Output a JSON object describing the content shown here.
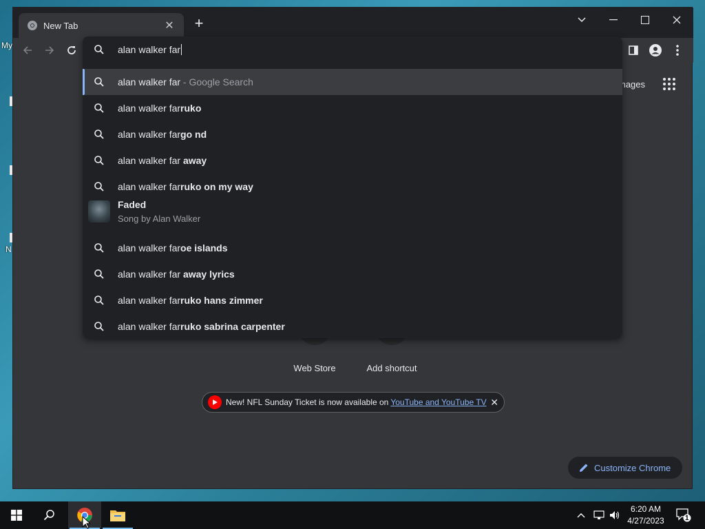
{
  "desktop": {
    "label_top": "My",
    "label_bottom": "N"
  },
  "tab": {
    "title": "New Tab"
  },
  "omnibox": {
    "query": "alan walker far",
    "suggestions": [
      {
        "typed": "alan walker far",
        "rest": "",
        "suffix": " - Google Search"
      },
      {
        "typed": "alan walker far",
        "rest": "ruko"
      },
      {
        "typed": "alan walker far",
        "rest": "go nd"
      },
      {
        "typed": "alan walker far ",
        "rest": "away"
      },
      {
        "typed": "alan walker far",
        "rest": "ruko on my way"
      },
      {
        "typed": "alan walker far",
        "rest": "oe islands"
      },
      {
        "typed": "alan walker far ",
        "rest": "away lyrics"
      },
      {
        "typed": "alan walker far",
        "rest": "ruko hans zimmer"
      },
      {
        "typed": "alan walker far",
        "rest": "ruko sabrina carpenter"
      }
    ],
    "entity": {
      "title": "Faded",
      "subtitle": "Song by Alan Walker"
    }
  },
  "ntp": {
    "images_link": "mages",
    "shortcuts": [
      {
        "label": "Web Store"
      },
      {
        "label": "Add shortcut"
      }
    ],
    "promo": {
      "text": "New! NFL Sunday Ticket is now available on",
      "link": "YouTube and YouTube TV"
    },
    "customize_label": "Customize Chrome"
  },
  "taskbar": {
    "time": "6:20 AM",
    "date": "4/27/2023",
    "notification_count": "1"
  },
  "colors": {
    "accent": "#8ab4f8",
    "window_bg": "#35363a",
    "dropdown_bg": "#202124"
  }
}
